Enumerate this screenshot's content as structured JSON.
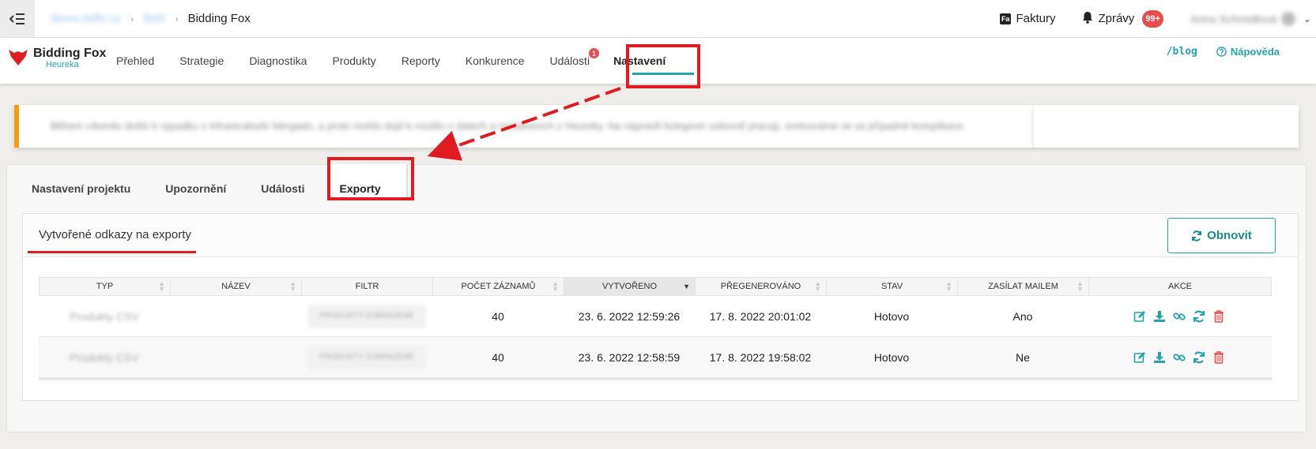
{
  "topbar": {
    "menu_icon": "collapse-menu-icon",
    "breadcrumb_1": "demo.bdfx.cz",
    "breadcrumb_2": "BdS",
    "app_title": "Bidding Fox",
    "faktury_label": "Faktury",
    "zpravy_label": "Zprávy",
    "zpravy_count": "99+",
    "user_name": "Anna Schmidlová"
  },
  "nav": {
    "logo_name": "Bidding Fox",
    "logo_sub": "Heureka",
    "items": [
      "Přehled",
      "Strategie",
      "Diagnostika",
      "Produkty",
      "Reporty",
      "Konkurence",
      "Události",
      "Nastavení"
    ],
    "events_badge": "1",
    "blog_label": "/blog",
    "help_label": "Nápověda"
  },
  "alert": {
    "text": "Během víkendu došlo k výpadku v infrastruktuře Mergado, a proto mohlo dojít k rozdílu v datech a nastaveních z Heureky. Na nápravě kolegové usilovně pracují, omlouváme se za případné komplikace."
  },
  "settings": {
    "tabs": [
      "Nastavení projektu",
      "Upozornění",
      "Události",
      "Exporty"
    ],
    "card_title": "Vytvořené odkazy na exporty",
    "refresh_label": "Obnovit"
  },
  "table": {
    "columns": [
      "TYP",
      "NÁZEV",
      "FILTR",
      "POČET ZÁZNAMŮ",
      "VYTVOŘENO",
      "PŘEGENEROVÁNO",
      "STAV",
      "ZASÍLAT MAILEM",
      "AKCE"
    ],
    "rows": [
      {
        "typ": "Produkty CSV",
        "nazev": "",
        "filtr": "PRODUKTY ZOBRAZENÉ",
        "pocet": "40",
        "vytvoreno": "23. 6. 2022 12:59:26",
        "pregenerovano": "17. 8. 2022 20:01:02",
        "stav": "Hotovo",
        "mail": "Ano"
      },
      {
        "typ": "Produkty CSV",
        "nazev": "",
        "filtr": "PRODUKTY ZOBRAZENÉ",
        "pocet": "40",
        "vytvoreno": "23. 6. 2022 12:58:59",
        "pregenerovano": "17. 8. 2022 19:58:02",
        "stav": "Hotovo",
        "mail": "Ne"
      }
    ]
  },
  "colors": {
    "accent": "#26a3a8",
    "highlight": "#e01b22",
    "alert": "#f39c12",
    "danger": "#e84c4c"
  }
}
